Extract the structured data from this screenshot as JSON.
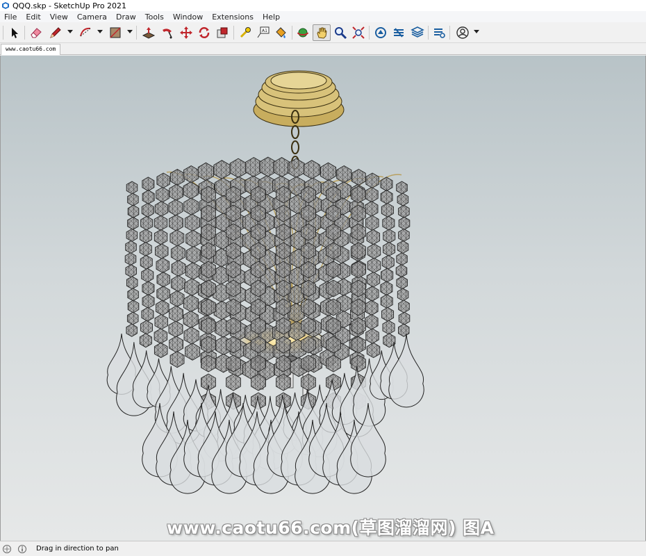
{
  "window": {
    "title": "QQQ.skp - SketchUp Pro 2021"
  },
  "menu": {
    "items": [
      "File",
      "Edit",
      "View",
      "Camera",
      "Draw",
      "Tools",
      "Window",
      "Extensions",
      "Help"
    ]
  },
  "toolbar": {
    "tools": [
      {
        "name": "select-tool",
        "icon": "arrow-cursor-icon"
      },
      {
        "name": "eraser-tool",
        "icon": "eraser-icon"
      },
      {
        "name": "line-tool",
        "icon": "pencil-icon"
      },
      {
        "name": "arc-tool",
        "icon": "arc-icon"
      },
      {
        "name": "rectangle-tool",
        "icon": "rectangle-icon"
      },
      {
        "name": "push-pull-tool",
        "icon": "push-pull-icon"
      },
      {
        "name": "follow-me-tool",
        "icon": "follow-me-icon"
      },
      {
        "name": "move-tool",
        "icon": "move-icon"
      },
      {
        "name": "rotate-tool",
        "icon": "rotate-icon"
      },
      {
        "name": "scale-tool",
        "icon": "scale-icon"
      },
      {
        "name": "tape-measure-tool",
        "icon": "tape-measure-icon"
      },
      {
        "name": "text-tool",
        "icon": "text-icon"
      },
      {
        "name": "paint-bucket-tool",
        "icon": "paint-bucket-icon"
      },
      {
        "name": "orbit-tool",
        "icon": "orbit-icon"
      },
      {
        "name": "pan-tool",
        "icon": "hand-icon"
      },
      {
        "name": "zoom-tool",
        "icon": "magnifier-icon"
      },
      {
        "name": "zoom-extents-tool",
        "icon": "zoom-extents-icon"
      },
      {
        "name": "3d-warehouse-button",
        "icon": "warehouse-icon"
      },
      {
        "name": "extension-warehouse-button",
        "icon": "extension-icon"
      },
      {
        "name": "layout-button",
        "icon": "layout-icon"
      },
      {
        "name": "extension-manager-button",
        "icon": "extension-manager-icon"
      },
      {
        "name": "account-button",
        "icon": "user-icon"
      }
    ],
    "active_tool": "pan-tool"
  },
  "tabs": {
    "scene_tab": "www.caotu66.com"
  },
  "viewport": {
    "watermark": "www.caotu66.com(草图溜溜网) 图A",
    "background_top": "#b8c3c7",
    "background_bottom": "#e6e8e8",
    "accent_gold": "#d8c27a"
  },
  "status": {
    "hint": "Drag in direction to pan"
  }
}
